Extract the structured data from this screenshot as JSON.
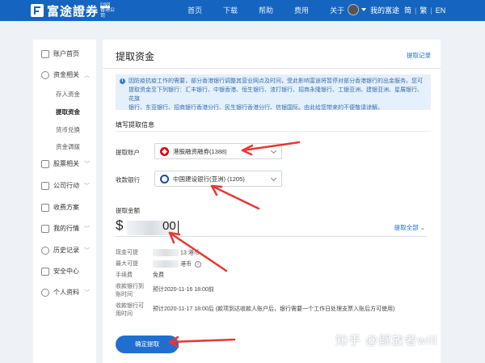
{
  "header": {
    "logo_text": "富途證券",
    "logo_badge_top": "國際",
    "logo_badge_bottom": "香港公司",
    "nav": [
      "首页",
      "下载",
      "帮助",
      "费用",
      "关于"
    ],
    "username": "我的富途",
    "lang_simplified": "简",
    "lang_traditional": "繁",
    "lang_english": "EN"
  },
  "sidebar": {
    "items": [
      {
        "label": "账户首页"
      },
      {
        "label": "资金相关"
      },
      {
        "label": "股票相关"
      },
      {
        "label": "公司行动"
      },
      {
        "label": "收费方案"
      },
      {
        "label": "我的行情"
      },
      {
        "label": "历史记录"
      },
      {
        "label": "安全中心"
      },
      {
        "label": "个人资料"
      }
    ],
    "subitems": [
      "存入资金",
      "提取资金",
      "货币兑换",
      "资金调拨"
    ],
    "active_subitem": "提取资金"
  },
  "main": {
    "title": "提取资金",
    "history_link": "提取记录",
    "notice_lines": [
      "因防疫抗疫工作的需要，部分香港银行调整其营业网点及时间，受此影响富途将暂停对部分香港银行的出金服务。您可",
      "提取资金至下列银行：汇丰银行、中银香港、恒生银行、渣打银行、招商永隆银行、工银亚洲、建银亚洲、星展银行、花旗",
      "银行、东亚银行、招商银行香港分行、民生银行香港分行、信银国际。由此给您带来的不便敬请谅解。"
    ],
    "section_title": "填写提取信息",
    "withdraw_account_label": "提取账户",
    "withdraw_account_value": "港股融资融券(1388)",
    "receiving_bank_label": "收款银行",
    "receiving_bank_value": "中国建设银行(亚洲) (1205)",
    "amount_label": "提取金额",
    "currency_symbol": "$",
    "amount_visible": "00",
    "withdraw_all": "提取全部",
    "info": [
      {
        "label": "现金可提",
        "value": "13 港币"
      },
      {
        "label": "最大可提",
        "value": "港币"
      },
      {
        "label": "手续费",
        "value": "免费"
      },
      {
        "label": "收款银行到账时间",
        "value": "预计2020-11-16 18:00前"
      },
      {
        "label": "收款银行可用时间",
        "value": "预计2020-11-17 18:00后 (款项到达收款人账户后，银行需要一个工作日处理支票入账后方可使用)"
      }
    ],
    "confirm_button": "确定提取"
  },
  "watermark": "知乎 @解放者will",
  "colors": {
    "brand_blue": "#1565c0",
    "link_blue": "#1f6fd1",
    "annotation_red": "#e53935"
  }
}
